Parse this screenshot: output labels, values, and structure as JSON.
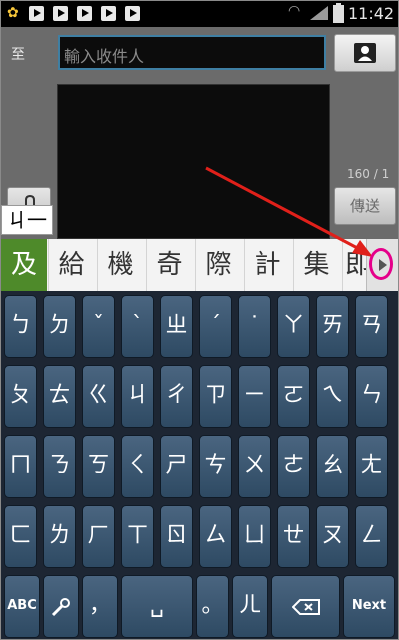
{
  "status_bar": {
    "time": "11:42",
    "notification_icons": [
      "flower-icon",
      "play-icon",
      "play-icon",
      "play-icon",
      "play-icon"
    ]
  },
  "compose": {
    "to_label": "至",
    "to_placeholder": "輸入收件人",
    "char_counter": "160 / 1",
    "send_label": "傳送",
    "composing_text": "ㄐ一"
  },
  "candidates": [
    "及",
    "給",
    "機",
    "奇",
    "際",
    "計",
    "集",
    "即"
  ],
  "keyboard": {
    "row1": [
      "ㄅ",
      "ㄉ",
      "ˇ",
      "ˋ",
      "ㄓ",
      "ˊ",
      "˙",
      "ㄚ",
      "ㄞ",
      "ㄢ"
    ],
    "row2": [
      "ㄆ",
      "ㄊ",
      "ㄍ",
      "ㄐ",
      "ㄔ",
      "ㄗ",
      "ㄧ",
      "ㄛ",
      "ㄟ",
      "ㄣ"
    ],
    "row3": [
      "ㄇ",
      "ㄋ",
      "ㄎ",
      "ㄑ",
      "ㄕ",
      "ㄘ",
      "ㄨ",
      "ㄜ",
      "ㄠ",
      "ㄤ"
    ],
    "row4": [
      "ㄈ",
      "ㄌ",
      "ㄏ",
      "ㄒ",
      "ㄖ",
      "ㄙ",
      "ㄩ",
      "ㄝ",
      "ㄡ",
      "ㄥ"
    ],
    "abc_label": "ABC",
    "space_label": "␣",
    "er_label": "ㄦ",
    "next_label": "Next"
  },
  "colors": {
    "candidate_selected": "#4e8a2a",
    "key_face": "#3d5a75",
    "annotation": "#e0201a",
    "highlight": "#e5008a"
  }
}
